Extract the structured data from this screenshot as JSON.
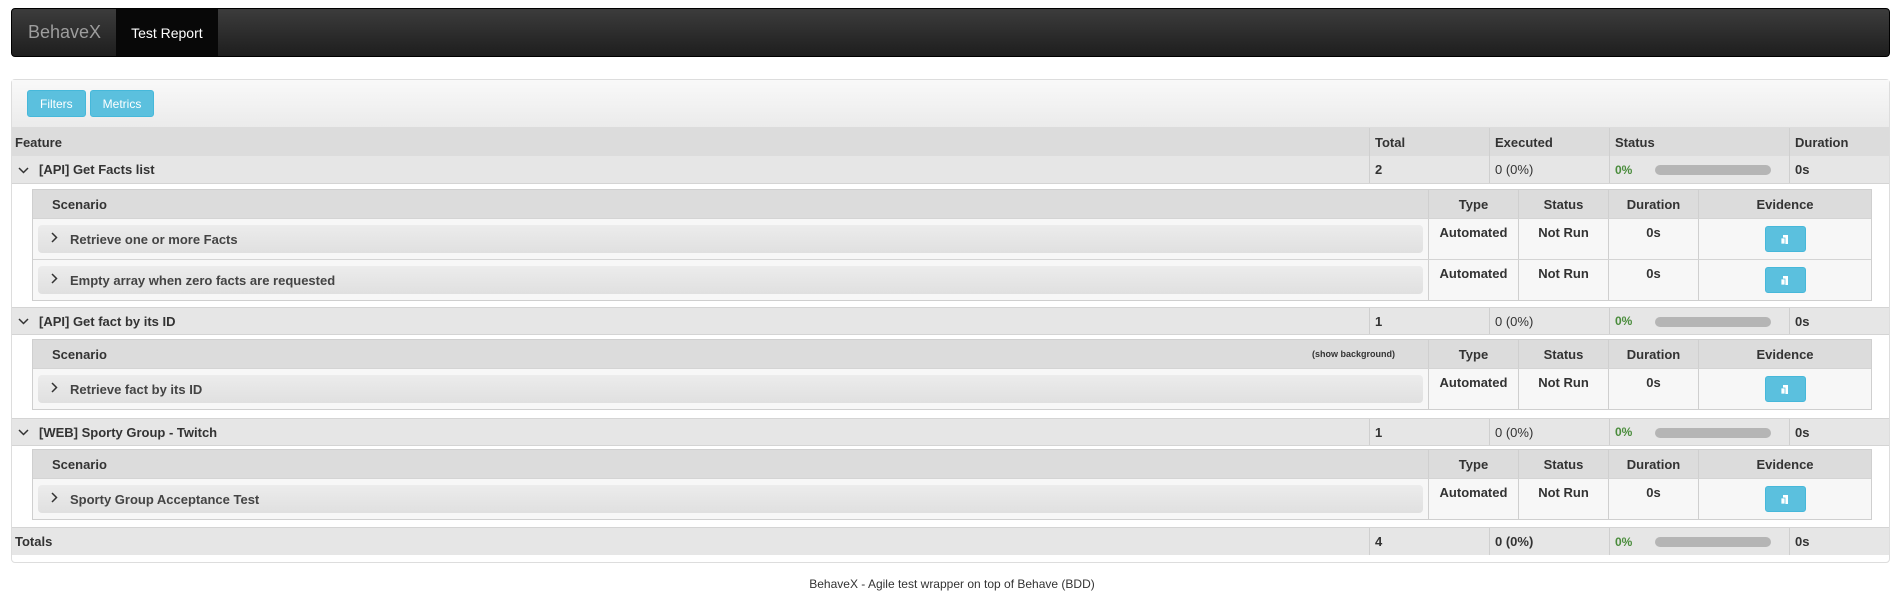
{
  "navbar": {
    "brand": "BehaveX",
    "active_tab": "Test Report"
  },
  "toolbar": {
    "filters_label": "Filters",
    "metrics_label": "Metrics"
  },
  "table_headers": {
    "feature": "Feature",
    "total": "Total",
    "executed": "Executed",
    "status": "Status",
    "duration": "Duration"
  },
  "scenario_headers": {
    "scenario": "Scenario",
    "type": "Type",
    "status": "Status",
    "duration": "Duration",
    "evidence": "Evidence",
    "show_background": "(show background)"
  },
  "features": [
    {
      "name": "[API] Get Facts list",
      "total": "2",
      "executed": "0 (0%)",
      "status_pct": "0%",
      "pass_fraction": 0,
      "duration": "0s",
      "scenarios": [
        {
          "name": "Retrieve one or more Facts",
          "type": "Automated",
          "status": "Not Run",
          "duration": "0s"
        },
        {
          "name": "Empty array when zero facts are requested",
          "type": "Automated",
          "status": "Not Run",
          "duration": "0s"
        }
      ]
    },
    {
      "name": "[API] Get fact by its ID",
      "total": "1",
      "executed": "0 (0%)",
      "status_pct": "0%",
      "pass_fraction": 0,
      "duration": "0s",
      "scenarios": [
        {
          "name": "Retrieve fact by its ID",
          "type": "Automated",
          "status": "Not Run",
          "duration": "0s"
        }
      ]
    },
    {
      "name": "[WEB] Sporty Group - Twitch",
      "total": "1",
      "executed": "0 (0%)",
      "status_pct": "0%",
      "pass_fraction": 0,
      "duration": "0s",
      "scenarios": [
        {
          "name": "Sporty Group Acceptance Test",
          "type": "Automated",
          "status": "Not Run",
          "duration": "0s"
        }
      ]
    }
  ],
  "totals": {
    "label": "Totals",
    "total": "4",
    "executed": "0 (0%)",
    "status_pct": "0%",
    "pass_fraction": 0,
    "duration": "0s"
  },
  "footer": "BehaveX - Agile test wrapper on top of Behave (BDD)",
  "icons": {
    "expanded": "chevron-down-icon",
    "collapsed": "chevron-right-icon",
    "evidence": "file-icon"
  },
  "colors": {
    "info_button": "#5bc0de",
    "status_pct": "#4a8c3c",
    "navbar": "#222222"
  }
}
